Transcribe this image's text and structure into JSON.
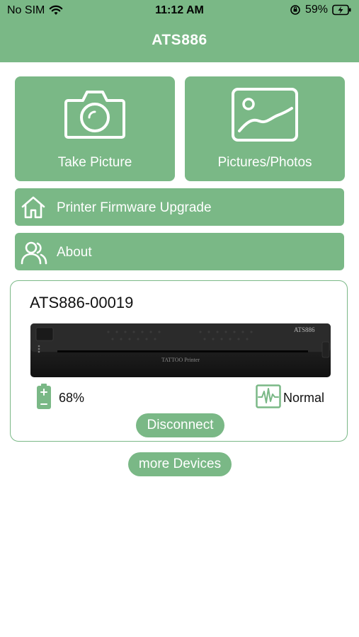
{
  "status_bar": {
    "carrier": "No SIM",
    "time": "11:12 AM",
    "battery_pct": "59%"
  },
  "header": {
    "title": "ATS886"
  },
  "tiles": [
    {
      "label": "Take Picture",
      "icon": "camera-icon"
    },
    {
      "label": "Pictures/Photos",
      "icon": "image-icon"
    }
  ],
  "menu": [
    {
      "label": "Printer Firmware Upgrade",
      "icon": "home-icon"
    },
    {
      "label": "About",
      "icon": "users-icon"
    }
  ],
  "device": {
    "name": "ATS886-00019",
    "printer_brand": "ATS886",
    "printer_model": "TATTOO Printer",
    "battery": "68%",
    "battery_level": 0.68,
    "state": "Normal",
    "disconnect_label": "Disconnect"
  },
  "more_devices_label": "more Devices",
  "colors": {
    "accent": "#7ab886",
    "white": "#ffffff"
  }
}
